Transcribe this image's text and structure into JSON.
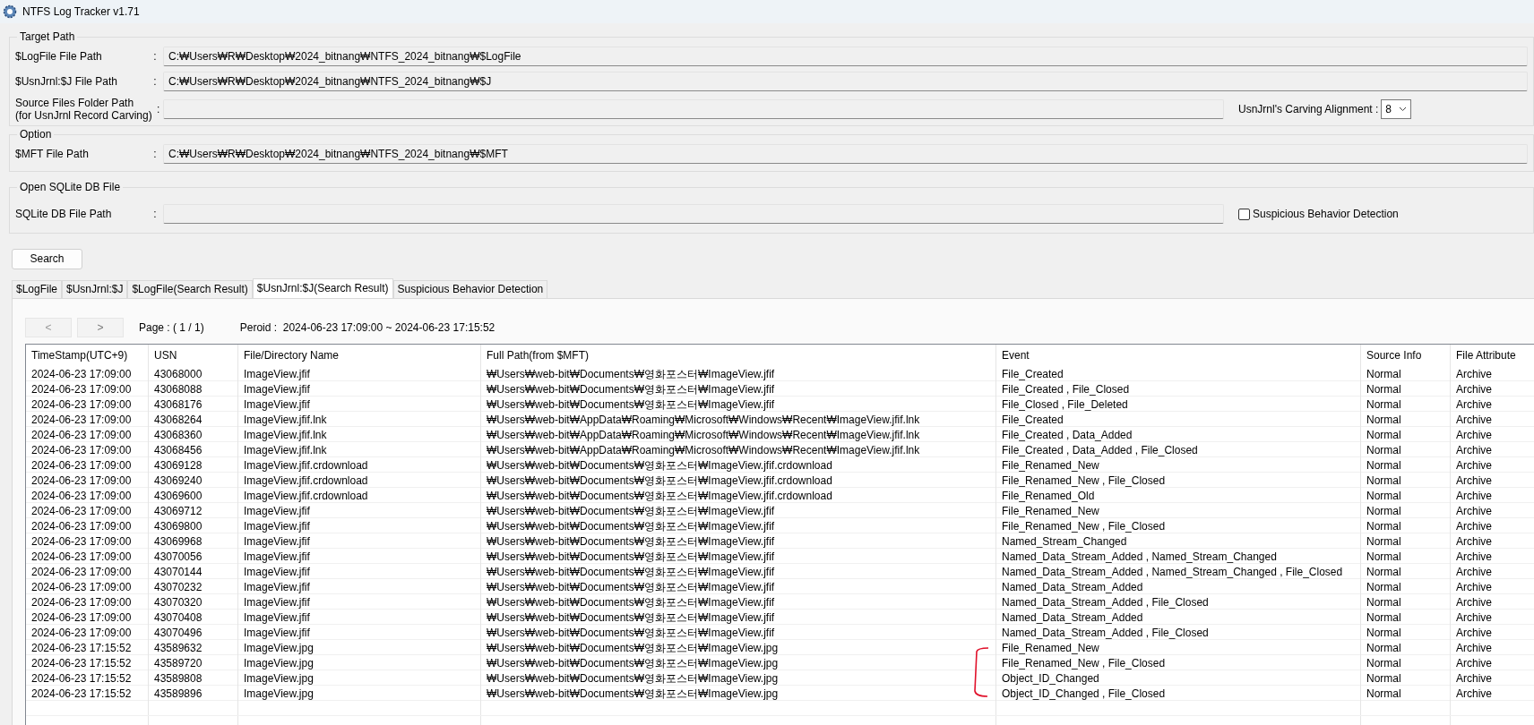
{
  "window": {
    "title": "NTFS Log Tracker v1.71"
  },
  "target_path": {
    "title": "Target Path",
    "fields": [
      {
        "label": "$LogFile File Path",
        "separator": ":",
        "value": "C:₩Users₩R₩Desktop₩2024_bitnang₩NTFS_2024_bitnang₩$LogFile"
      },
      {
        "label": "$UsnJrnl:$J File Path",
        "separator": ":",
        "value": "C:₩Users₩R₩Desktop₩2024_bitnang₩NTFS_2024_bitnang₩$J"
      }
    ],
    "source_folder": {
      "label": "Source Files Folder Path",
      "sublabel": "(for UsnJrnl Record Carving)",
      "separator": ":"
    },
    "carving_alignment": {
      "label": "UsnJrnl's Carving Alignment :",
      "value": "8"
    }
  },
  "option": {
    "title": "Option",
    "fields": [
      {
        "label": "$MFT File Path",
        "separator": ":",
        "value": "C:₩Users₩R₩Desktop₩2024_bitnang₩NTFS_2024_bitnang₩$MFT"
      }
    ]
  },
  "sqlite": {
    "title": "Open SQLite DB File",
    "label": "SQLite DB File Path",
    "separator": ":",
    "checkbox": {
      "label": "Suspicious Behavior Detection",
      "checked": false
    }
  },
  "search_button": "Search",
  "tabs": [
    {
      "label": "$LogFile",
      "selected": false
    },
    {
      "label": "$UsnJrnl:$J",
      "selected": false
    },
    {
      "label": "$LogFile(Search Result)",
      "selected": false
    },
    {
      "label": "$UsnJrnl:$J(Search Result)",
      "selected": true
    },
    {
      "label": "Suspicious Behavior Detection",
      "selected": false
    }
  ],
  "pager": {
    "prev": "<",
    "next": ">",
    "page": "Page : ( 1 / 1)",
    "period": "Peroid :  2024-06-23 17:09:00 ~ 2024-06-23 17:15:52"
  },
  "table": {
    "columns": [
      "TimeStamp(UTC+9)",
      "USN",
      "File/Directory Name",
      "Full Path(from $MFT)",
      "Event",
      "Source Info",
      "File Attribute"
    ],
    "rows": [
      [
        "2024-06-23 17:09:00",
        "43068000",
        "ImageView.jfif",
        "₩Users₩web-bit₩Documents₩영화포스터₩ImageView.jfif",
        "File_Created",
        "Normal",
        "Archive"
      ],
      [
        "2024-06-23 17:09:00",
        "43068088",
        "ImageView.jfif",
        "₩Users₩web-bit₩Documents₩영화포스터₩ImageView.jfif",
        "File_Created , File_Closed",
        "Normal",
        "Archive"
      ],
      [
        "2024-06-23 17:09:00",
        "43068176",
        "ImageView.jfif",
        "₩Users₩web-bit₩Documents₩영화포스터₩ImageView.jfif",
        "File_Closed , File_Deleted",
        "Normal",
        "Archive"
      ],
      [
        "2024-06-23 17:09:00",
        "43068264",
        "ImageView.jfif.lnk",
        "₩Users₩web-bit₩AppData₩Roaming₩Microsoft₩Windows₩Recent₩ImageView.jfif.lnk",
        "File_Created",
        "Normal",
        "Archive"
      ],
      [
        "2024-06-23 17:09:00",
        "43068360",
        "ImageView.jfif.lnk",
        "₩Users₩web-bit₩AppData₩Roaming₩Microsoft₩Windows₩Recent₩ImageView.jfif.lnk",
        "File_Created , Data_Added",
        "Normal",
        "Archive"
      ],
      [
        "2024-06-23 17:09:00",
        "43068456",
        "ImageView.jfif.lnk",
        "₩Users₩web-bit₩AppData₩Roaming₩Microsoft₩Windows₩Recent₩ImageView.jfif.lnk",
        "File_Created , Data_Added , File_Closed",
        "Normal",
        "Archive"
      ],
      [
        "2024-06-23 17:09:00",
        "43069128",
        "ImageView.jfif.crdownload",
        "₩Users₩web-bit₩Documents₩영화포스터₩ImageView.jfif.crdownload",
        "File_Renamed_New",
        "Normal",
        "Archive"
      ],
      [
        "2024-06-23 17:09:00",
        "43069240",
        "ImageView.jfif.crdownload",
        "₩Users₩web-bit₩Documents₩영화포스터₩ImageView.jfif.crdownload",
        "File_Renamed_New , File_Closed",
        "Normal",
        "Archive"
      ],
      [
        "2024-06-23 17:09:00",
        "43069600",
        "ImageView.jfif.crdownload",
        "₩Users₩web-bit₩Documents₩영화포스터₩ImageView.jfif.crdownload",
        "File_Renamed_Old",
        "Normal",
        "Archive"
      ],
      [
        "2024-06-23 17:09:00",
        "43069712",
        "ImageView.jfif",
        "₩Users₩web-bit₩Documents₩영화포스터₩ImageView.jfif",
        "File_Renamed_New",
        "Normal",
        "Archive"
      ],
      [
        "2024-06-23 17:09:00",
        "43069800",
        "ImageView.jfif",
        "₩Users₩web-bit₩Documents₩영화포스터₩ImageView.jfif",
        "File_Renamed_New , File_Closed",
        "Normal",
        "Archive"
      ],
      [
        "2024-06-23 17:09:00",
        "43069968",
        "ImageView.jfif",
        "₩Users₩web-bit₩Documents₩영화포스터₩ImageView.jfif",
        "Named_Stream_Changed",
        "Normal",
        "Archive"
      ],
      [
        "2024-06-23 17:09:00",
        "43070056",
        "ImageView.jfif",
        "₩Users₩web-bit₩Documents₩영화포스터₩ImageView.jfif",
        "Named_Data_Stream_Added , Named_Stream_Changed",
        "Normal",
        "Archive"
      ],
      [
        "2024-06-23 17:09:00",
        "43070144",
        "ImageView.jfif",
        "₩Users₩web-bit₩Documents₩영화포스터₩ImageView.jfif",
        "Named_Data_Stream_Added , Named_Stream_Changed , File_Closed",
        "Normal",
        "Archive"
      ],
      [
        "2024-06-23 17:09:00",
        "43070232",
        "ImageView.jfif",
        "₩Users₩web-bit₩Documents₩영화포스터₩ImageView.jfif",
        "Named_Data_Stream_Added",
        "Normal",
        "Archive"
      ],
      [
        "2024-06-23 17:09:00",
        "43070320",
        "ImageView.jfif",
        "₩Users₩web-bit₩Documents₩영화포스터₩ImageView.jfif",
        "Named_Data_Stream_Added , File_Closed",
        "Normal",
        "Archive"
      ],
      [
        "2024-06-23 17:09:00",
        "43070408",
        "ImageView.jfif",
        "₩Users₩web-bit₩Documents₩영화포스터₩ImageView.jfif",
        "Named_Data_Stream_Added",
        "Normal",
        "Archive"
      ],
      [
        "2024-06-23 17:09:00",
        "43070496",
        "ImageView.jfif",
        "₩Users₩web-bit₩Documents₩영화포스터₩ImageView.jfif",
        "Named_Data_Stream_Added , File_Closed",
        "Normal",
        "Archive"
      ],
      [
        "2024-06-23 17:15:52",
        "43589632",
        "ImageView.jpg",
        "₩Users₩web-bit₩Documents₩영화포스터₩ImageView.jpg",
        "File_Renamed_New",
        "Normal",
        "Archive"
      ],
      [
        "2024-06-23 17:15:52",
        "43589720",
        "ImageView.jpg",
        "₩Users₩web-bit₩Documents₩영화포스터₩ImageView.jpg",
        "File_Renamed_New , File_Closed",
        "Normal",
        "Archive"
      ],
      [
        "2024-06-23 17:15:52",
        "43589808",
        "ImageView.jpg",
        "₩Users₩web-bit₩Documents₩영화포스터₩ImageView.jpg",
        "Object_ID_Changed",
        "Normal",
        "Archive"
      ],
      [
        "2024-06-23 17:15:52",
        "43589896",
        "ImageView.jpg",
        "₩Users₩web-bit₩Documents₩영화포스터₩ImageView.jpg",
        "Object_ID_Changed , File_Closed",
        "Normal",
        "Archive"
      ]
    ]
  }
}
